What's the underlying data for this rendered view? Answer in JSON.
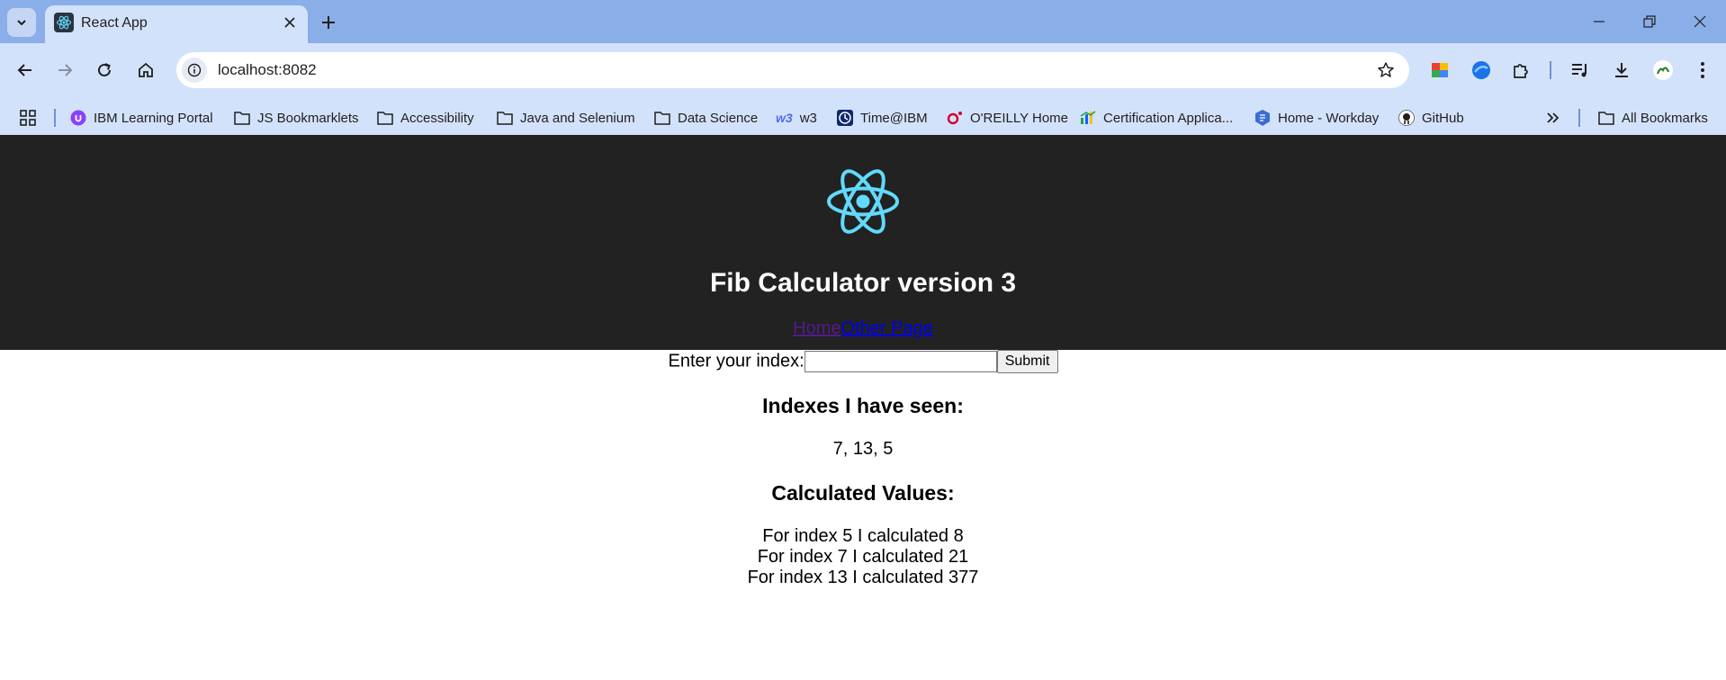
{
  "browser": {
    "tab_title": "React App",
    "url": "localhost:8082",
    "bookmarks": [
      {
        "label": "IBM Learning Portal",
        "icon": "ibm-learning-icon"
      },
      {
        "label": "JS Bookmarklets",
        "icon": "folder-icon"
      },
      {
        "label": "Accessibility",
        "icon": "folder-icon"
      },
      {
        "label": "Java and Selenium",
        "icon": "folder-icon"
      },
      {
        "label": "Data Science",
        "icon": "folder-icon"
      },
      {
        "label": "w3",
        "icon": "w3-icon",
        "icon_text": "w3"
      },
      {
        "label": "Time@IBM",
        "icon": "clock-icon"
      },
      {
        "label": "O'REILLY Home",
        "icon": "oreilly-icon"
      },
      {
        "label": "Certification Applica...",
        "icon": "chart-icon"
      },
      {
        "label": "Home - Workday",
        "icon": "workday-icon"
      },
      {
        "label": "GitHub",
        "icon": "github-icon"
      }
    ],
    "all_bookmarks": "All Bookmarks"
  },
  "app": {
    "title": "Fib Calculator version 3",
    "nav": {
      "home": "Home",
      "other": "Other Page"
    },
    "form": {
      "label": "Enter your index:",
      "value": "",
      "submit": "Submit"
    },
    "seen_heading": "Indexes I have seen:",
    "seen_values": "7, 13, 5",
    "calc_heading": "Calculated Values:",
    "calculated": [
      "For index 5 I calculated 8",
      "For index 7 I calculated 21",
      "For index 13 I calculated 377"
    ]
  },
  "colors": {
    "header_bg": "#222222",
    "react_blue": "#61dafb",
    "browser_frame": "#8aaee8",
    "toolbar": "#d3e2fb"
  }
}
